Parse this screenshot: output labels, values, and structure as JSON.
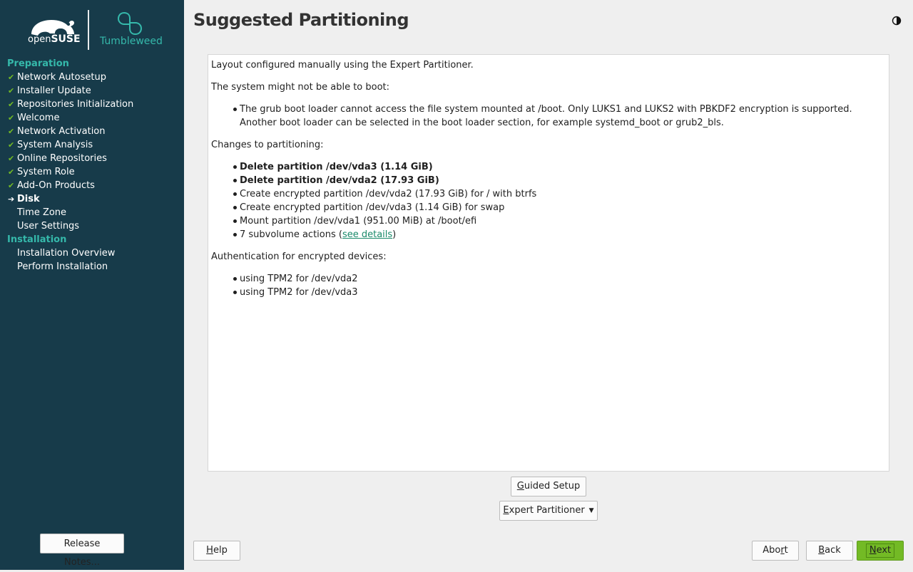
{
  "sidebar": {
    "brand": {
      "opensuse_prefix": "open",
      "opensuse_suffix": "SUSE",
      "product": "Tumbleweed"
    },
    "sections": [
      {
        "header": "Preparation",
        "steps": [
          {
            "label": "Network Autosetup",
            "state": "done"
          },
          {
            "label": "Installer Update",
            "state": "done"
          },
          {
            "label": "Repositories Initialization",
            "state": "done"
          },
          {
            "label": "Welcome",
            "state": "done"
          },
          {
            "label": "Network Activation",
            "state": "done"
          },
          {
            "label": "System Analysis",
            "state": "done"
          },
          {
            "label": "Online Repositories",
            "state": "done"
          },
          {
            "label": "System Role",
            "state": "done"
          },
          {
            "label": "Add-On Products",
            "state": "done"
          },
          {
            "label": "Disk",
            "state": "current"
          },
          {
            "label": "Time Zone",
            "state": "todo"
          },
          {
            "label": "User Settings",
            "state": "todo"
          }
        ]
      },
      {
        "header": "Installation",
        "steps": [
          {
            "label": "Installation Overview",
            "state": "todo"
          },
          {
            "label": "Perform Installation",
            "state": "todo"
          }
        ]
      }
    ],
    "release_notes_label": "Release Notes..."
  },
  "page": {
    "title": "Suggested Partitioning"
  },
  "content": {
    "intro": "Layout configured manually using the Expert Partitioner.",
    "boot_warning_heading": "The system might not be able to boot:",
    "boot_warning_items": [
      "The grub boot loader cannot access the file system mounted at /boot. Only LUKS1 and LUKS2 with PBKDF2 encryption is supported. Another boot loader can be selected in the boot loader section, for example systemd_boot or grub2_bls."
    ],
    "changes_heading": "Changes to partitioning:",
    "changes": [
      {
        "text": "Delete partition /dev/vda3 (1.14 GiB)",
        "bold": true
      },
      {
        "text": "Delete partition /dev/vda2 (17.93 GiB)",
        "bold": true
      },
      {
        "text": "Create encrypted partition /dev/vda2 (17.93 GiB) for / with btrfs",
        "bold": false
      },
      {
        "text": "Create encrypted partition /dev/vda3 (1.14 GiB) for swap",
        "bold": false
      },
      {
        "text": "Mount partition /dev/vda1 (951.00 MiB) at /boot/efi",
        "bold": false
      }
    ],
    "subvolume_prefix": "7 subvolume actions (",
    "subvolume_link": "see details",
    "subvolume_suffix": ")",
    "auth_heading": "Authentication for encrypted devices:",
    "auth_items": [
      "using TPM2 for /dev/vda2",
      "using TPM2 for /dev/vda3"
    ]
  },
  "buttons": {
    "guided_setup": {
      "first": "G",
      "rest": "uided Setup"
    },
    "expert_partitioner": {
      "first": "E",
      "rest": "xpert Partitioner"
    },
    "help": {
      "first": "H",
      "rest": "elp"
    },
    "abort": {
      "before": "Abo",
      "u": "r",
      "after": "t"
    },
    "back": {
      "first": "B",
      "rest": "ack"
    },
    "next": {
      "first": "N",
      "rest": "ext"
    }
  },
  "colors": {
    "sidebar_bg": "#173b4a",
    "accent_teal": "#35b9ab",
    "check_green": "#73ba25",
    "next_green": "#73ba25"
  },
  "icons": {
    "done": "check-icon",
    "current": "arrow-right-icon",
    "theme": "half-moon-icon",
    "dropdown": "caret-down-icon"
  }
}
